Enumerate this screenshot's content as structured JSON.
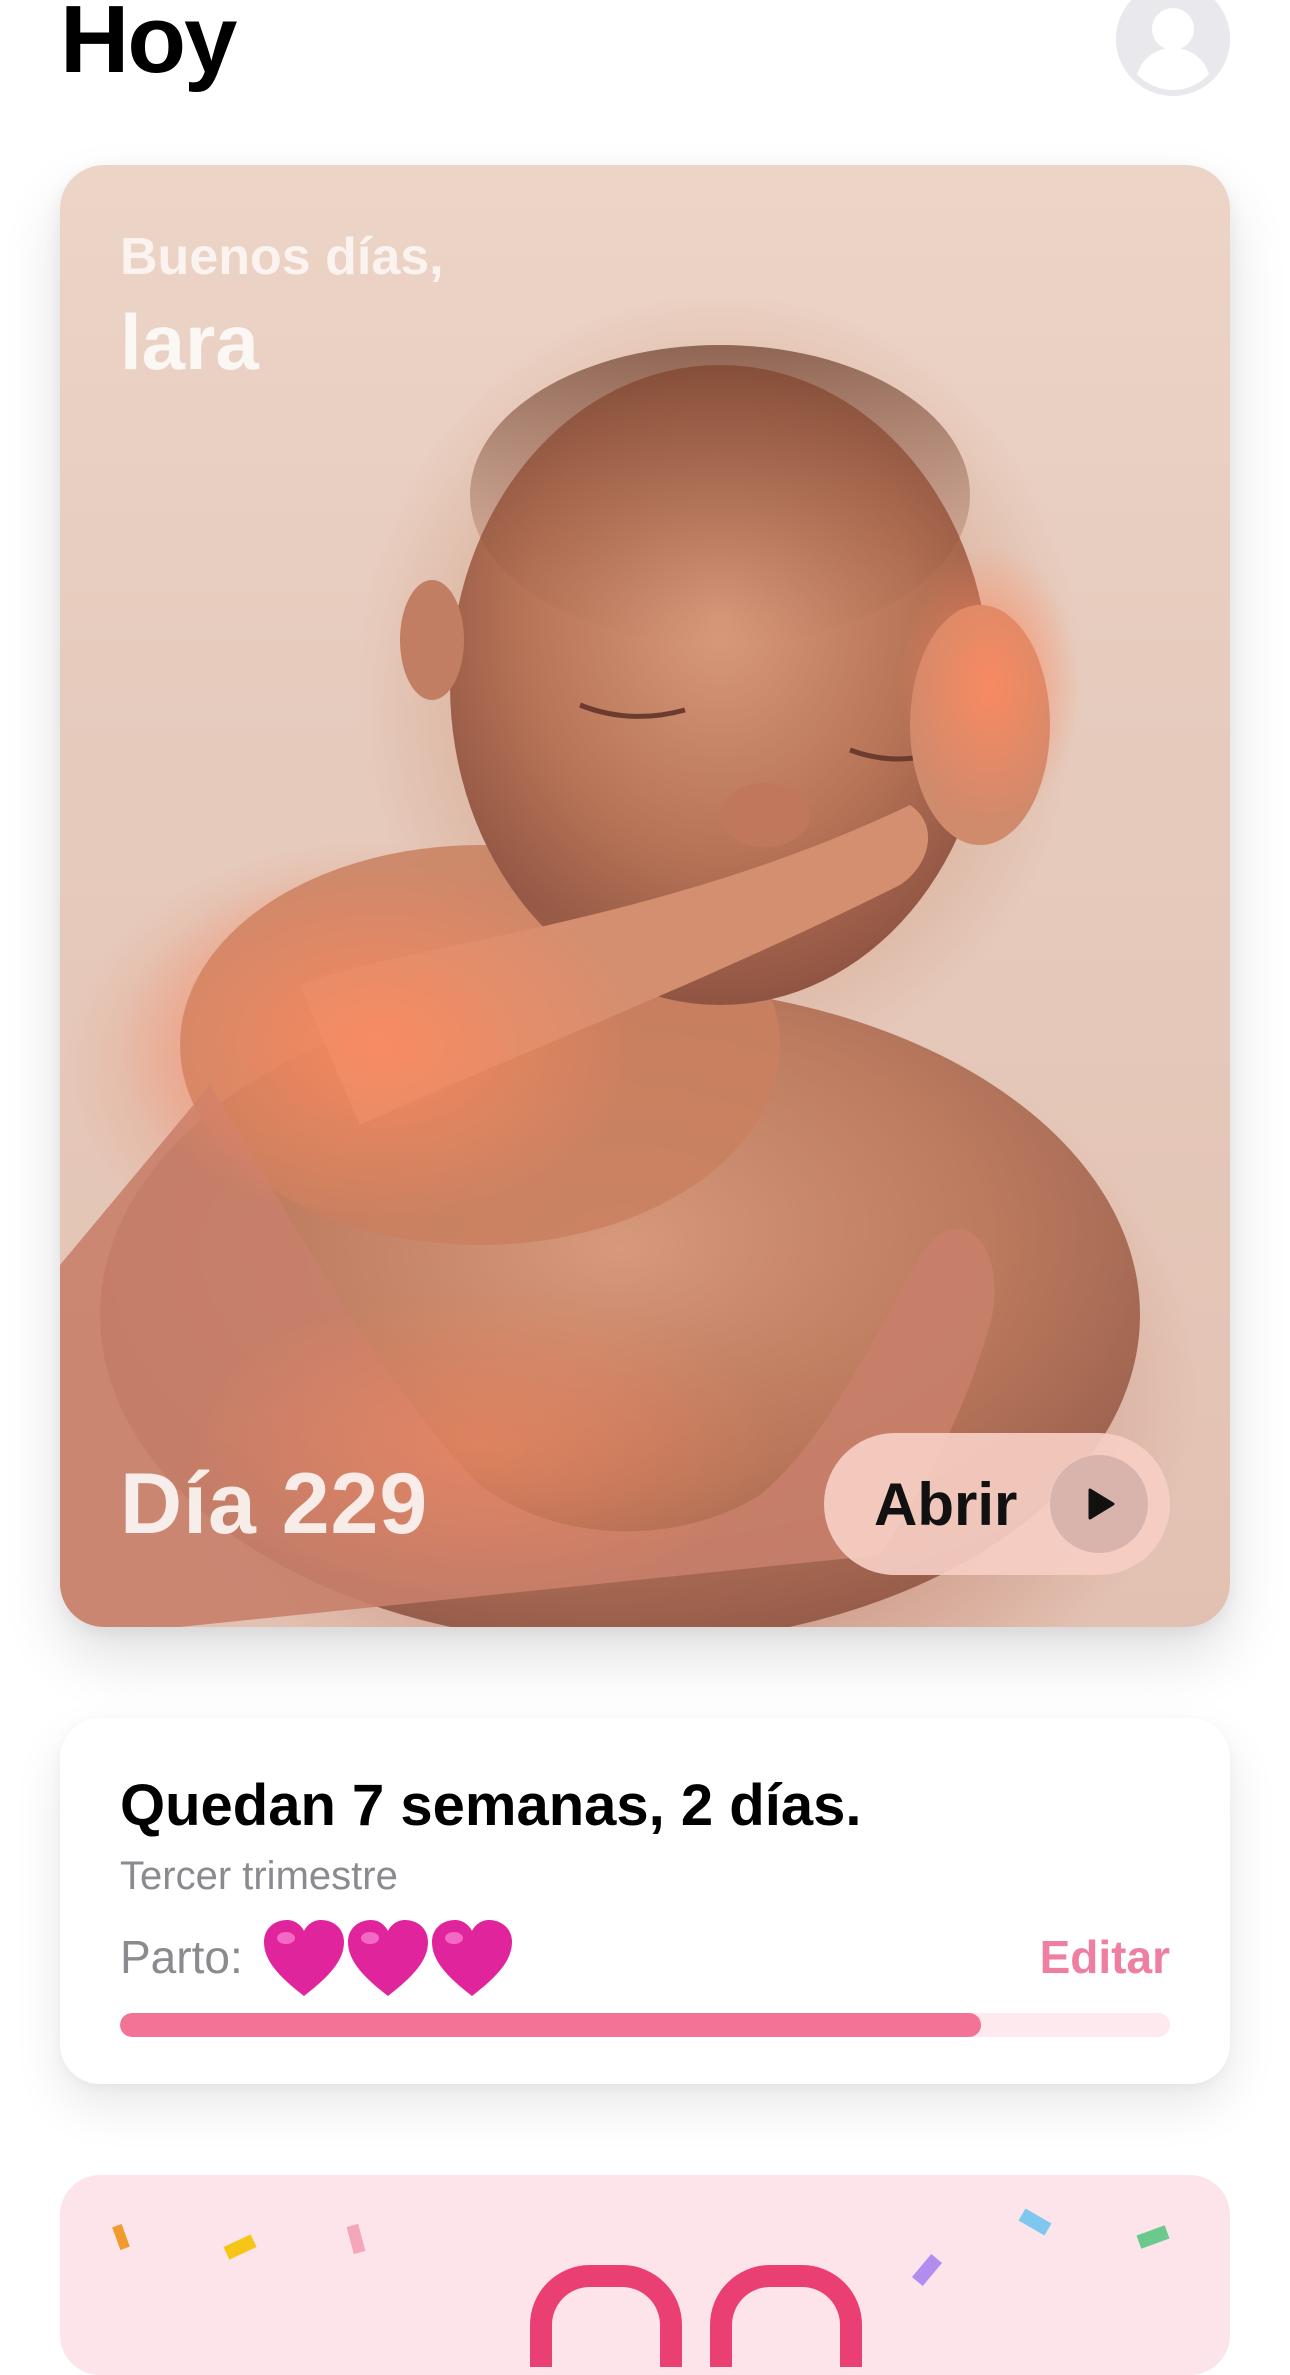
{
  "header": {
    "title": "Hoy",
    "avatar_icon": "person-circle-icon"
  },
  "hero": {
    "greeting": "Buenos días,",
    "name": "lara",
    "day": "Día 229",
    "open_label": "Abrir",
    "play_icon": "play-icon"
  },
  "countdown": {
    "title": "Quedan 7 semanas, 2 días.",
    "trimester": "Tercer trimestre",
    "due_label": "Parto:",
    "due_hearts_icon": "heart-emoji-icon",
    "edit_label": "Editar",
    "progress": 0.82
  },
  "colors": {
    "accent": "#ef7fa0",
    "progress_fill": "#f27396",
    "progress_track": "#fde9ee",
    "celebration_bg": "#fce4ea"
  }
}
